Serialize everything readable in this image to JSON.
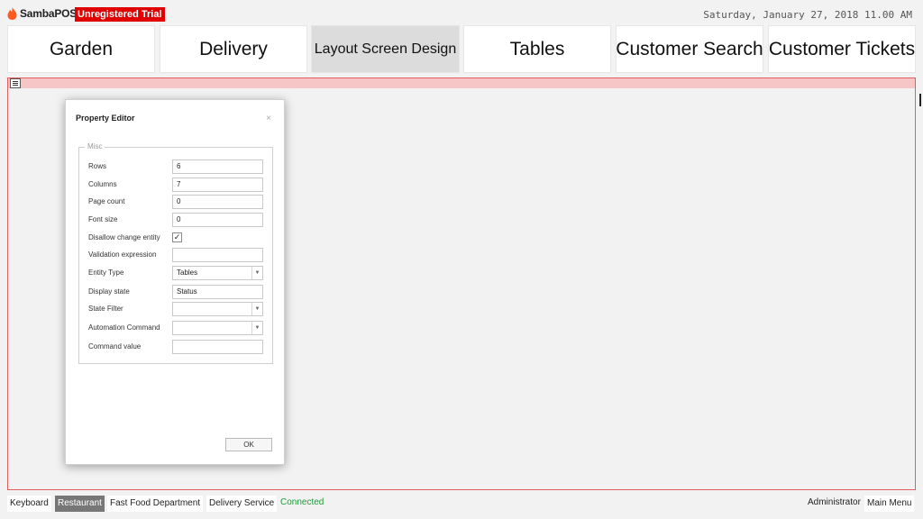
{
  "app": {
    "name": "SambaPOS",
    "trial_badge": "Unregistered Trial",
    "datetime": "Saturday, January 27, 2018 11.00 AM",
    "colors": {
      "brand_red": "#e00000",
      "design_border": "#e06060",
      "connected_green": "#1f9a3a"
    }
  },
  "tiles": [
    {
      "label": "Garden"
    },
    {
      "label": "Delivery"
    },
    {
      "label": "Layout Screen Design",
      "active": true
    },
    {
      "label": "Tables"
    },
    {
      "label": "Customer Search"
    },
    {
      "label": "Customer Tickets"
    }
  ],
  "dialog": {
    "title": "Property Editor",
    "close_glyph": "×",
    "group_title": "Misc",
    "fields": {
      "rows": {
        "label": "Rows",
        "value": "6"
      },
      "columns": {
        "label": "Columns",
        "value": "7"
      },
      "page_count": {
        "label": "Page count",
        "value": "0"
      },
      "font_size": {
        "label": "Font size",
        "value": "0"
      },
      "disallow_change_entity": {
        "label": "Disallow change entity",
        "checked": true,
        "glyph": "✓"
      },
      "validation_expression": {
        "label": "Validation expression",
        "value": ""
      },
      "entity_type": {
        "label": "Entity Type",
        "value": "Tables",
        "arrow": "▼"
      },
      "display_state": {
        "label": "Display state",
        "value": "Status"
      },
      "state_filter": {
        "label": "State Filter",
        "value": "",
        "arrow": "▼"
      },
      "automation_command": {
        "label": "Automation Command",
        "value": "",
        "arrow": "▼"
      },
      "command_value": {
        "label": "Command value",
        "value": ""
      }
    },
    "ok_label": "OK"
  },
  "statusbar": {
    "keyboard": "Keyboard",
    "restaurant": "Restaurant",
    "fast_food": "Fast Food Department",
    "delivery_service": "Delivery Service",
    "connected": "Connected",
    "user": "Administrator",
    "main_menu": "Main Menu"
  }
}
